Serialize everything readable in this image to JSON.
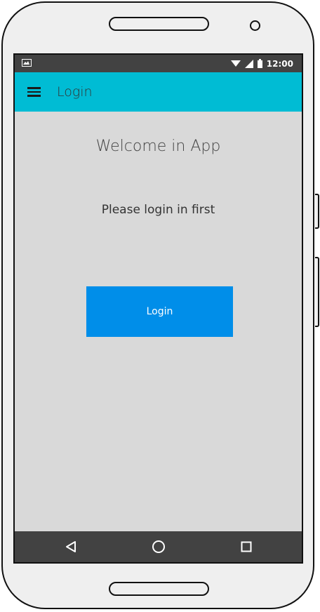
{
  "status_bar": {
    "time": "12:00",
    "icons": [
      "image-icon",
      "wifi-icon",
      "signal-icon",
      "battery-icon"
    ]
  },
  "app_bar": {
    "title": "Login",
    "menu_icon": "menu-icon",
    "color": "#00bcd4"
  },
  "main": {
    "welcome": "Welcome in App",
    "prompt": "Please login in first",
    "login_button_label": "Login",
    "button_color": "#008ee9",
    "background": "#d9d9d9"
  },
  "nav_bar": {
    "icons": [
      "back-icon",
      "home-icon",
      "recent-apps-icon"
    ]
  }
}
